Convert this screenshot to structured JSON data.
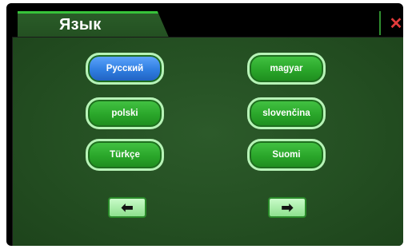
{
  "header": {
    "title": "Язык",
    "close_icon": "close-icon"
  },
  "languages": {
    "russian": "Русский",
    "magyar": "magyar",
    "polski": "polski",
    "slovencina": "slovenčina",
    "turkce": "Türkçe",
    "suomi": "Suomi"
  },
  "navigation": {
    "prev_icon": "arrow-left-icon",
    "next_icon": "arrow-right-icon"
  },
  "colors": {
    "accent_green": "#37c33a",
    "selected_blue": "#2f7de0",
    "close_red": "#e23b3b"
  }
}
